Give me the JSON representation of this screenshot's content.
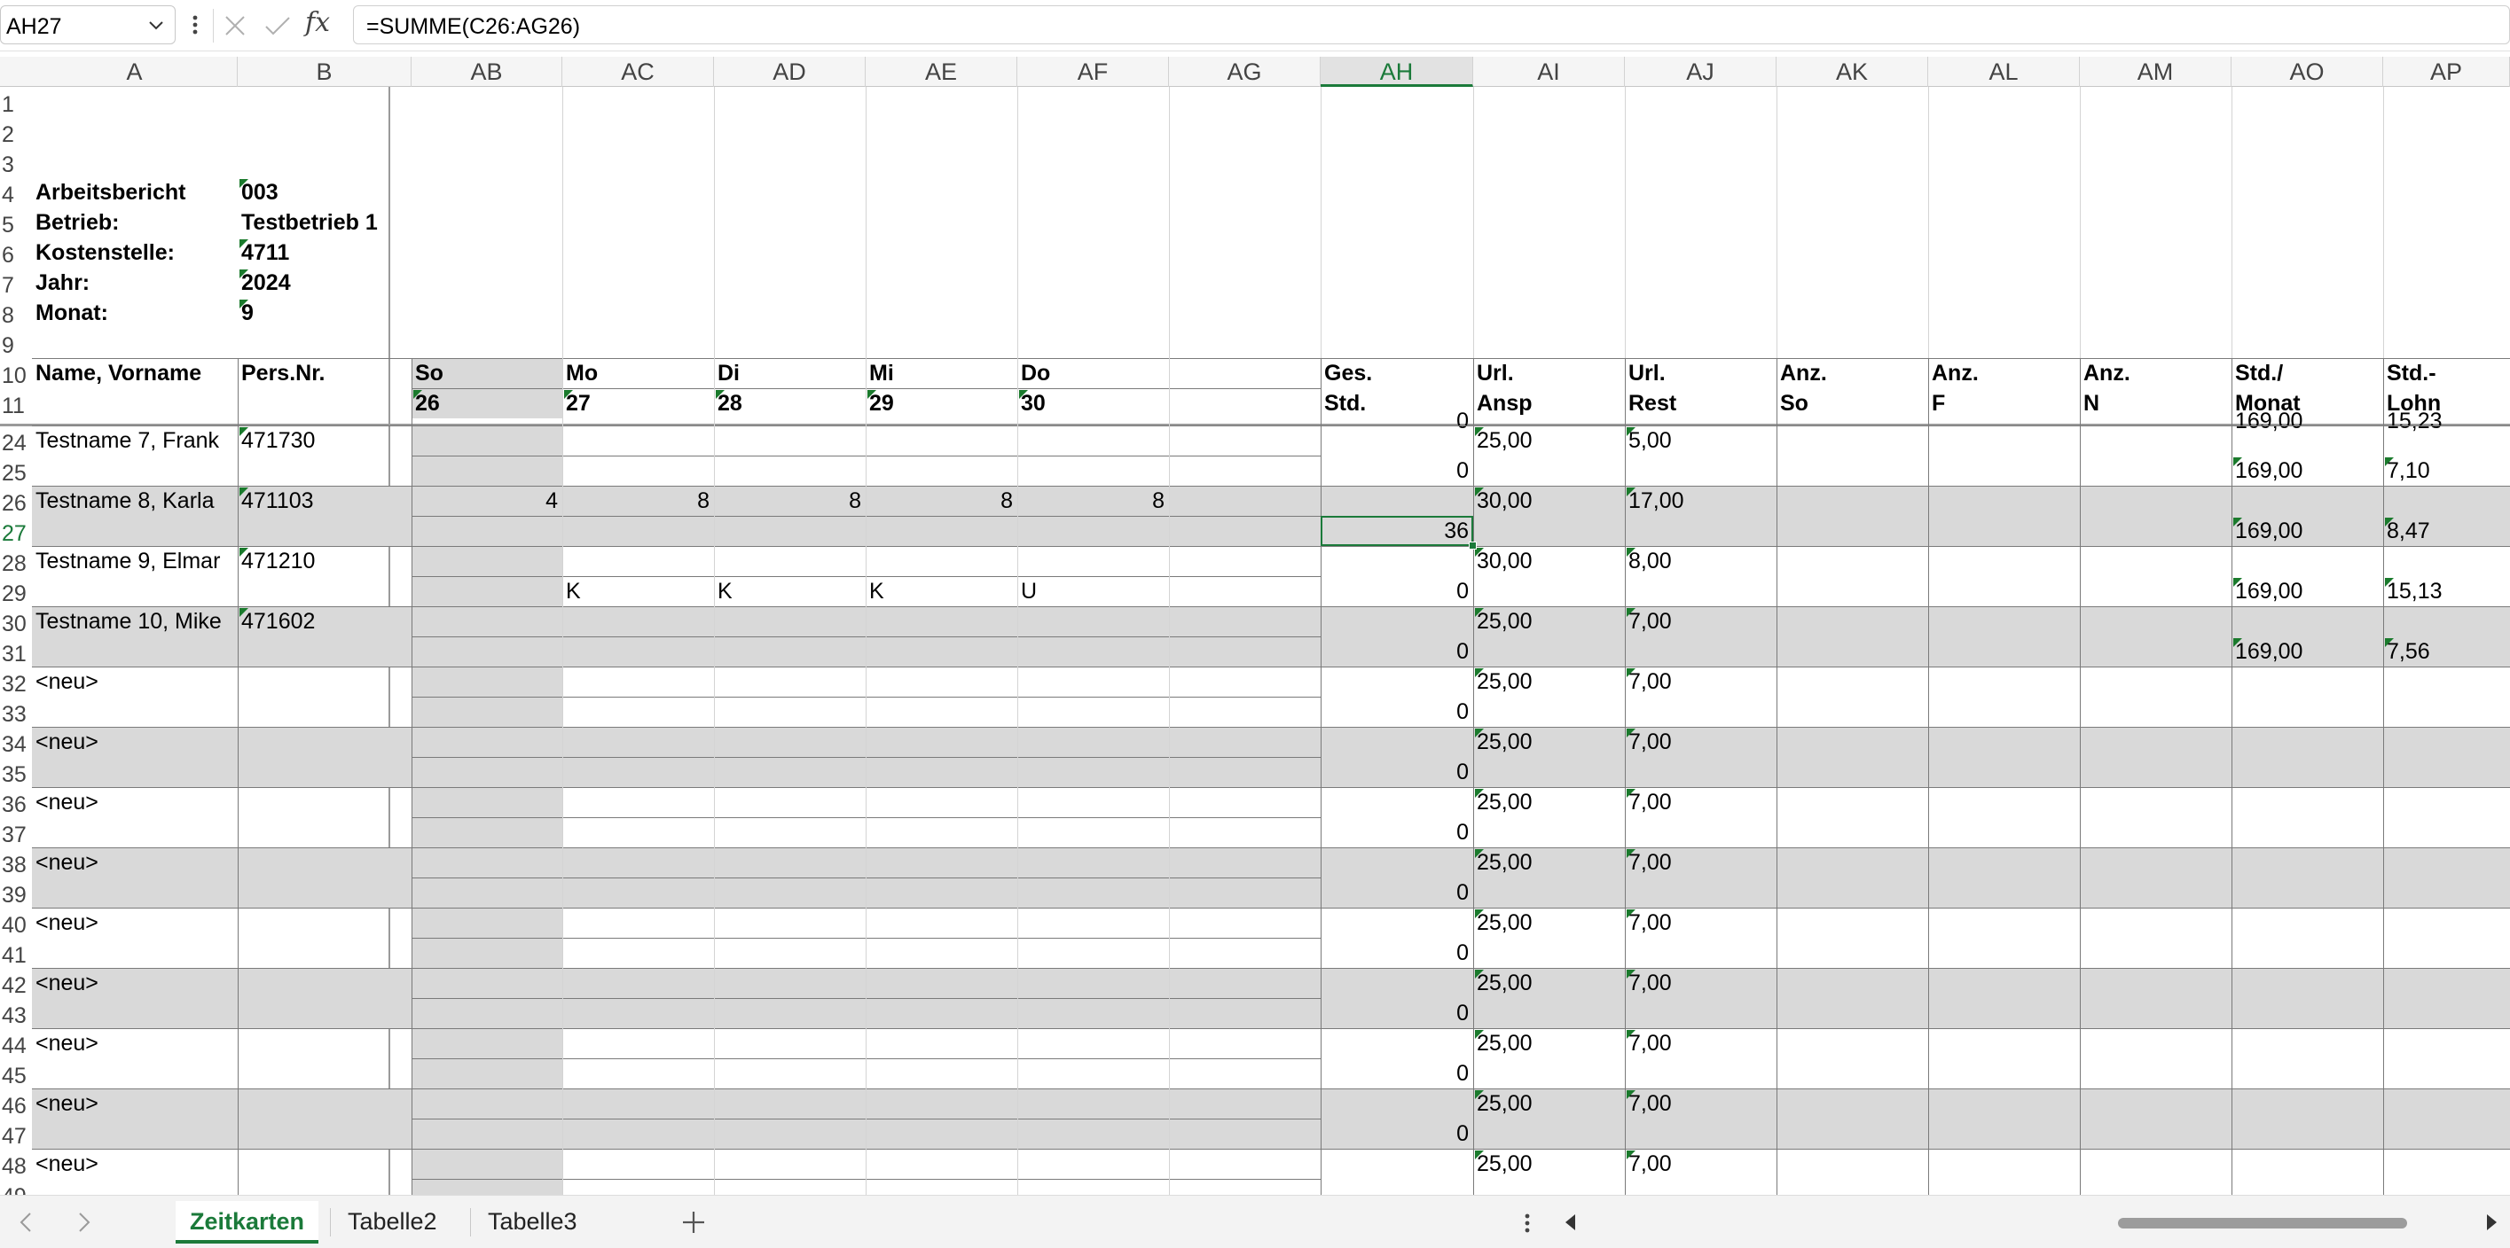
{
  "formula_bar": {
    "name_box": "AH27",
    "formula": "=SUMME(C26:AG26)"
  },
  "columns": [
    "A",
    "B",
    "AB",
    "AC",
    "AD",
    "AE",
    "AF",
    "AG",
    "AH",
    "AI",
    "AJ",
    "AK",
    "AL",
    "AM",
    "AO",
    "AP"
  ],
  "selected_column": "AH",
  "selected_row": "27",
  "header": {
    "labels": [
      {
        "label": "Arbeitsbericht",
        "value": "003"
      },
      {
        "label": "Betrieb:",
        "value": "Testbetrieb 1"
      },
      {
        "label": "Kostenstelle:",
        "value": "4711"
      },
      {
        "label": "Jahr:",
        "value": "2024"
      },
      {
        "label": "Monat:",
        "value": "9"
      }
    ]
  },
  "table_header": {
    "row10": [
      "Name, Vorname",
      "Pers.Nr.",
      "So",
      "Mo",
      "Di",
      "Mi",
      "Do",
      "",
      "Ges.",
      "Url.",
      "Url.",
      "Anz.",
      "Anz.",
      "Anz.",
      "Std./",
      "Std.-"
    ],
    "row11": [
      "",
      "",
      "26",
      "27",
      "28",
      "29",
      "30",
      "",
      "Std.",
      "Ansp",
      "Rest",
      "So",
      "F",
      "N",
      "Monat",
      "Lohn"
    ]
  },
  "employees": [
    {
      "name": "Testname 7, Frank",
      "persnr": "471730",
      "days": [
        "",
        "",
        "",
        "",
        "",
        ""
      ],
      "days2": [
        "",
        "",
        "",
        "",
        "",
        ""
      ],
      "ges": "0",
      "url_ansp": "25,00",
      "url_rest": "5,00",
      "std_monat": "169,00",
      "std_lohn": "7,10"
    },
    {
      "name": "Testname 8, Karla",
      "persnr": "471103",
      "days": [
        "4",
        "8",
        "8",
        "8",
        "8",
        ""
      ],
      "days2": [
        "",
        "",
        "",
        "",
        "",
        ""
      ],
      "ges": "36",
      "url_ansp": "30,00",
      "url_rest": "17,00",
      "std_monat": "169,00",
      "std_lohn": "8,47"
    },
    {
      "name": "Testname 9, Elmar",
      "persnr": "471210",
      "days": [
        "",
        "",
        "",
        "",
        "",
        ""
      ],
      "days2": [
        "",
        "K",
        "K",
        "K",
        "U",
        ""
      ],
      "ges": "0",
      "url_ansp": "30,00",
      "url_rest": "8,00",
      "std_monat": "169,00",
      "std_lohn": "15,13"
    },
    {
      "name": "Testname 10, Mike",
      "persnr": "471602",
      "days": [
        "",
        "",
        "",
        "",
        "",
        ""
      ],
      "days2": [
        "",
        "",
        "",
        "",
        "",
        ""
      ],
      "ges": "0",
      "url_ansp": "25,00",
      "url_rest": "7,00",
      "std_monat": "169,00",
      "std_lohn": "7,56"
    },
    {
      "name": "<neu>",
      "persnr": "",
      "ges": "0",
      "url_ansp": "25,00",
      "url_rest": "7,00",
      "std_monat": "",
      "std_lohn": ""
    },
    {
      "name": "<neu>",
      "persnr": "",
      "ges": "0",
      "url_ansp": "25,00",
      "url_rest": "7,00",
      "std_monat": "",
      "std_lohn": ""
    },
    {
      "name": "<neu>",
      "persnr": "",
      "ges": "0",
      "url_ansp": "25,00",
      "url_rest": "7,00",
      "std_monat": "",
      "std_lohn": ""
    },
    {
      "name": "<neu>",
      "persnr": "",
      "ges": "0",
      "url_ansp": "25,00",
      "url_rest": "7,00",
      "std_monat": "",
      "std_lohn": ""
    },
    {
      "name": "<neu>",
      "persnr": "",
      "ges": "0",
      "url_ansp": "25,00",
      "url_rest": "7,00",
      "std_monat": "",
      "std_lohn": ""
    },
    {
      "name": "<neu>",
      "persnr": "",
      "ges": "0",
      "url_ansp": "25,00",
      "url_rest": "7,00",
      "std_monat": "",
      "std_lohn": ""
    },
    {
      "name": "<neu>",
      "persnr": "",
      "ges": "0",
      "url_ansp": "25,00",
      "url_rest": "7,00",
      "std_monat": "",
      "std_lohn": ""
    },
    {
      "name": "<neu>",
      "persnr": "",
      "ges": "0",
      "url_ansp": "25,00",
      "url_rest": "7,00",
      "std_monat": "",
      "std_lohn": ""
    },
    {
      "name": "<neu>",
      "persnr": "",
      "ges": "",
      "url_ansp": "25,00",
      "url_rest": "7,00",
      "std_monat": "",
      "std_lohn": ""
    }
  ],
  "first_employee_row": 24,
  "clipped_row_above": {
    "ah": "0",
    "ao": "169,00",
    "ap": "15,23"
  },
  "sheets": {
    "tabs": [
      "Zeitkarten",
      "Tabelle2",
      "Tabelle3"
    ],
    "active": "Zeitkarten"
  },
  "colors": {
    "accent": "#1b7a3a",
    "band": "#d9d9d9",
    "marker": "#1a7a2c"
  }
}
